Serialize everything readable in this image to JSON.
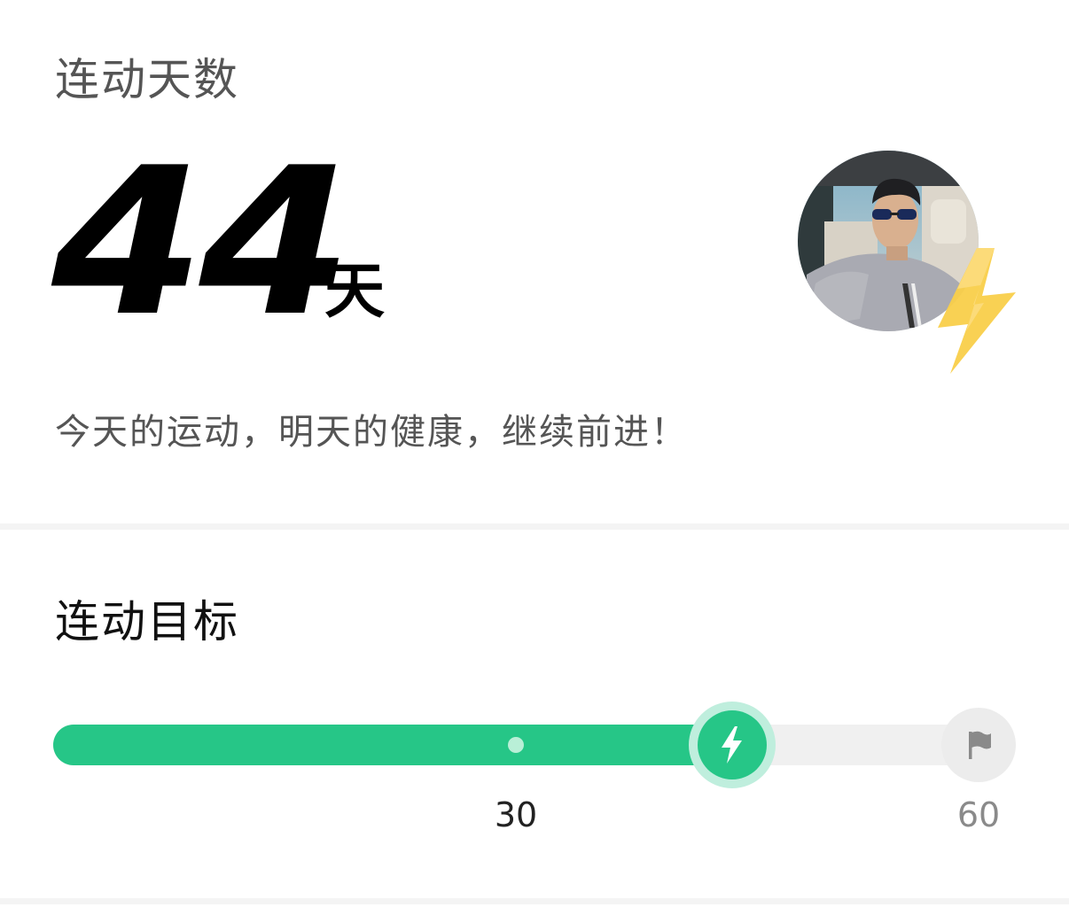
{
  "streak": {
    "title": "连动天数",
    "days": "44",
    "unit": "天",
    "motto": "今天的运动，明天的健康，继续前进！",
    "avatar_icon": "user-avatar-photo",
    "badge_icon": "lightning-bolt-icon",
    "badge_color": "#f9cf4a"
  },
  "goal": {
    "title": "连动目标",
    "current_days": 44,
    "target_days": 60,
    "milestone_days": 30,
    "milestone_label": "30",
    "target_label": "60",
    "current_icon": "lightning-bolt-icon",
    "target_icon": "flag-icon",
    "accent_color": "#26c687",
    "track_color": "#f0f0f0"
  }
}
